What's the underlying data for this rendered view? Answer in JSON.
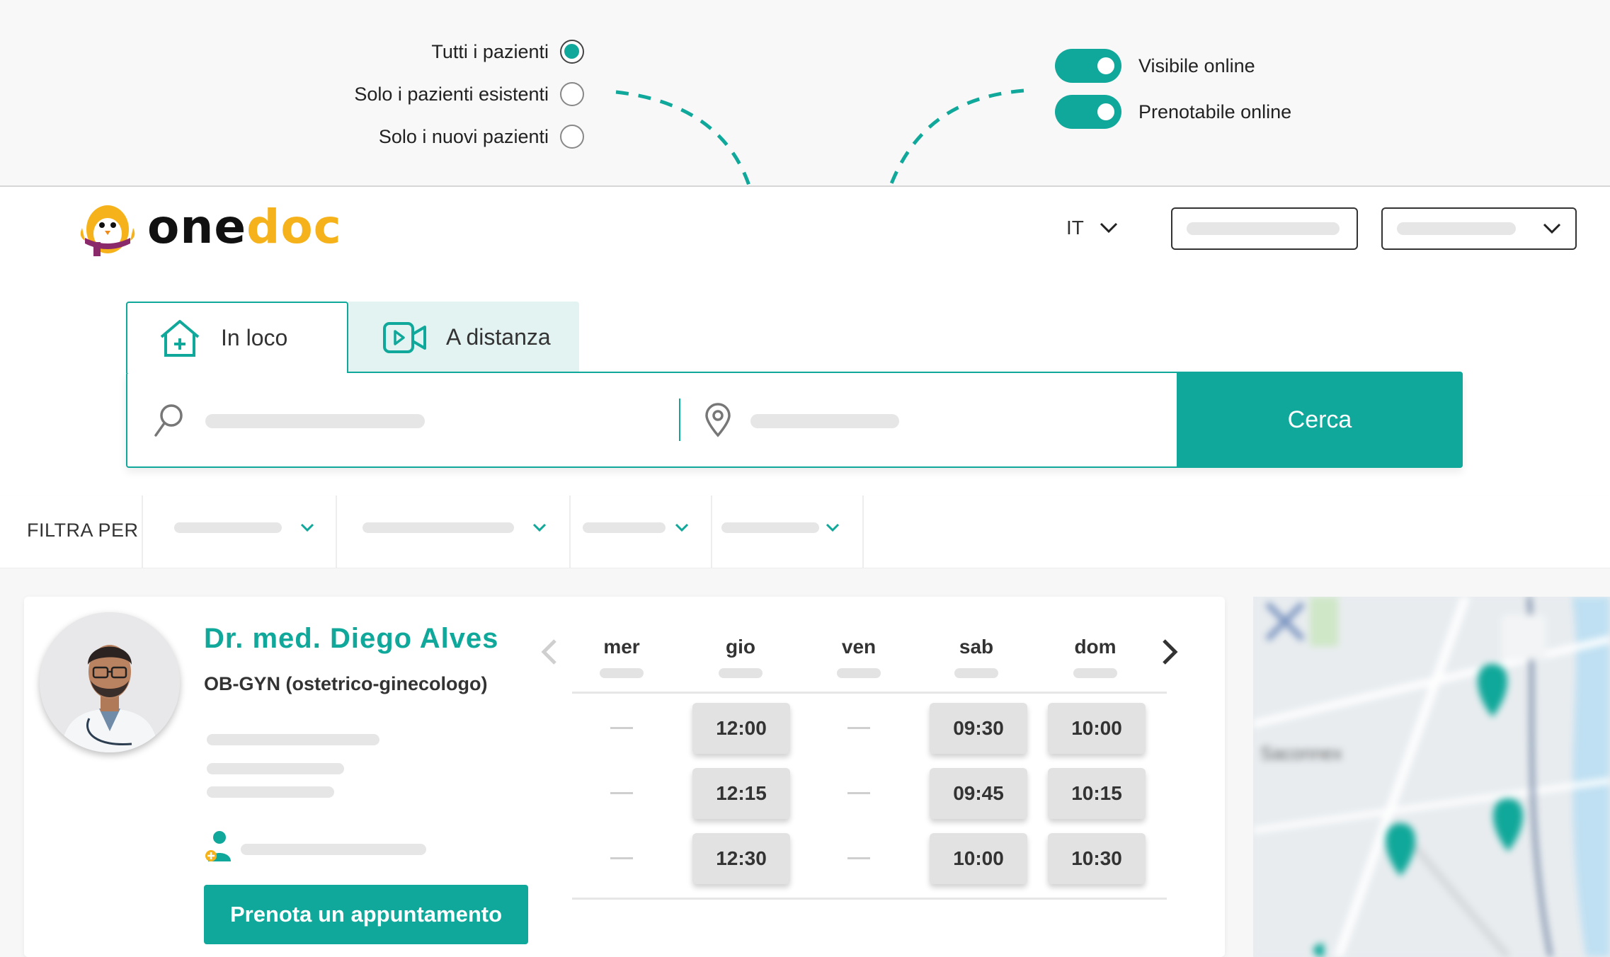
{
  "audience_options": [
    {
      "label": "Tutti i pazienti",
      "checked": true
    },
    {
      "label": "Solo i pazienti esistenti",
      "checked": false
    },
    {
      "label": "Solo i nuovi pazienti",
      "checked": false
    }
  ],
  "toggles": [
    {
      "label": "Visibile online",
      "on": true
    },
    {
      "label": "Prenotabile online",
      "on": true
    }
  ],
  "header": {
    "logo_one": "one",
    "logo_doc": "doc",
    "language": "IT"
  },
  "search": {
    "tab_onsite": "In loco",
    "tab_remote": "A distanza",
    "button": "Cerca"
  },
  "filters": {
    "label": "FILTRA PER"
  },
  "doctor": {
    "name": "Dr. med. Diego Alves",
    "specialty": "OB-GYN (ostetrico-ginecologo)",
    "book_button": "Prenota un appuntamento"
  },
  "calendar": {
    "days": [
      "mer",
      "gio",
      "ven",
      "sab",
      "dom"
    ],
    "slots": [
      [
        null,
        null,
        null
      ],
      [
        "12:00",
        "12:15",
        "12:30"
      ],
      [
        null,
        null,
        null
      ],
      [
        "09:30",
        "09:45",
        "10:00"
      ],
      [
        "10:00",
        "10:15",
        "10:30"
      ]
    ]
  },
  "colors": {
    "accent": "#10a89a",
    "logo_yellow": "#f6b21b",
    "tab_inactive_bg": "#e2f3f1"
  }
}
